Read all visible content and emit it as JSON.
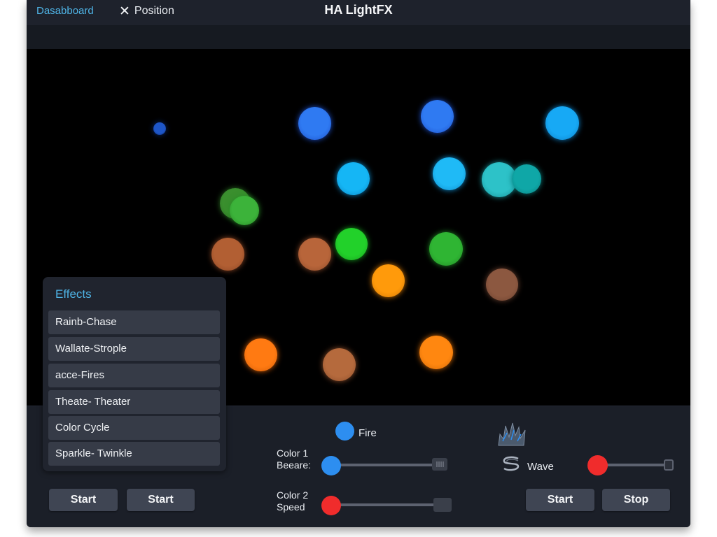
{
  "header": {
    "tab_dashboard": "Dasabboard",
    "tab_position": "Position",
    "title": "HA LightFX"
  },
  "lights": [
    {
      "color": "#1e56c8",
      "glow": "#0b2a6e"
    },
    {
      "color": "#2f7af2",
      "glow": "#1d4fc9"
    },
    {
      "color": "#2f7af2",
      "glow": "#1d4fc9"
    },
    {
      "color": "#17a9f5",
      "glow": "#0d7fc6"
    },
    {
      "color": "#15b6f5",
      "glow": "#0c86c5"
    },
    {
      "color": "#1fbaf6",
      "glow": "#0f88c8"
    },
    {
      "color": "#2dc2c8",
      "glow": "#168f95"
    },
    {
      "color": "#0fa7a7",
      "glow": "#0a7a7a"
    },
    {
      "color": "#3a8f2e",
      "glow": "#2a6b22"
    },
    {
      "color": "#3cb33a",
      "glow": "#278a26"
    },
    {
      "color": "#b25f33",
      "glow": "#8a4524"
    },
    {
      "color": "#b8653a",
      "glow": "#8c4a29"
    },
    {
      "color": "#22d12a",
      "glow": "#17a11e"
    },
    {
      "color": "#2fb533",
      "glow": "#208825"
    },
    {
      "color": "#ff9a0b",
      "glow": "#d27605"
    },
    {
      "color": "#8c5840",
      "glow": "#6b412f"
    },
    {
      "color": "#ff7a12",
      "glow": "#d45d08"
    },
    {
      "color": "#b56a3d",
      "glow": "#8c4e2b"
    },
    {
      "color": "#ff8710",
      "glow": "#d16807"
    }
  ],
  "effects": {
    "title": "Effects",
    "items": [
      "Rainb-Chase",
      "Wallate-Strople",
      "acce-Fires",
      "Theate- Theater",
      "Color Cycle",
      "Sparkle- Twinkle"
    ]
  },
  "controls": {
    "fire_label": "Fire",
    "fire_swatch_color": "#2d8ef0",
    "color1_label": "Color 1",
    "color1_sub": "Beeare:",
    "color2_label": "Color 2",
    "color2_sub": "Speed",
    "wave_label": "Wave",
    "slider1_value": 0.0,
    "slider2_value": 0.0,
    "slider3_value": 0.0,
    "slider1_thumb_color": "#2d8ef0",
    "slider2_thumb_color": "#f02c2c",
    "slider3_thumb_color": "#f02c2c",
    "fire_icon": "fire-icon",
    "wave_icon": "wave-icon"
  },
  "buttons": {
    "start_1": "Start",
    "start_2": "Start",
    "start_3": "Start",
    "stop": "Stop"
  }
}
